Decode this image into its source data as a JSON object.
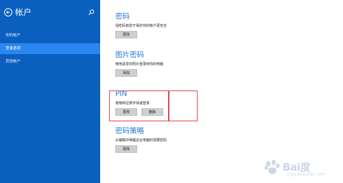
{
  "sidebar": {
    "title": "帐户",
    "items": [
      {
        "label": "你的帐户",
        "selected": false
      },
      {
        "label": "登录选项",
        "selected": true
      },
      {
        "label": "其他帐户",
        "selected": false
      }
    ]
  },
  "sections": {
    "password": {
      "title": "密码",
      "desc": "强密码有助于保护你的帐户更安全",
      "buttons": [
        "更改"
      ]
    },
    "picture_password": {
      "title": "图片密码",
      "desc": "使用喜爱的照片登录到你的电脑",
      "buttons": [
        "添加"
      ]
    },
    "pin": {
      "title": "PIN",
      "desc": "使用四位数字快速登录",
      "buttons": [
        "更改",
        "删除"
      ]
    },
    "password_policy": {
      "title": "密码策略",
      "desc": "从睡眠中唤醒这台电脑时需要密码",
      "buttons": [
        "更改"
      ]
    }
  },
  "watermark": {
    "brand": "Bai度",
    "sub": "jingyan.baidu.com"
  },
  "colors": {
    "sidebar_bg": "#0a5fbf",
    "sidebar_selected": "#2a86f0",
    "section_title": "#2a78d8",
    "highlight": "#e4424c"
  }
}
